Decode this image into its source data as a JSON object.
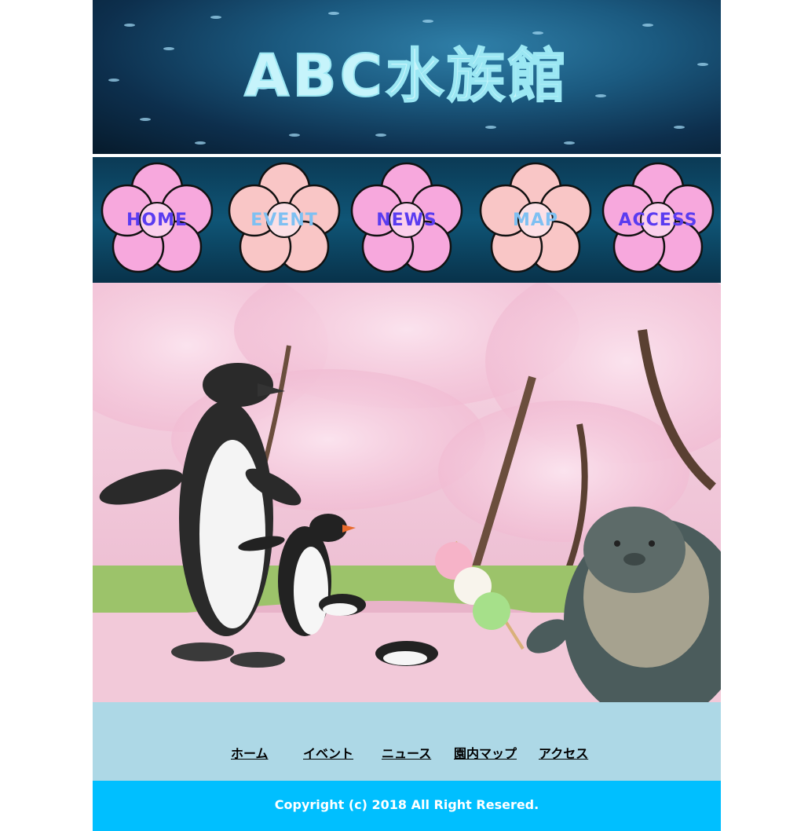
{
  "header": {
    "title": "ABC水族館"
  },
  "nav": {
    "items": [
      {
        "label": "HOME",
        "label_color": "#5a3cf0"
      },
      {
        "label": "EVENT",
        "label_color": "#7ec0f2"
      },
      {
        "label": "NEWS",
        "label_color": "#5a3cf0"
      },
      {
        "label": "MAP",
        "label_color": "#7ec0f2"
      },
      {
        "label": "ACCESS",
        "label_color": "#5a3cf0"
      }
    ],
    "flower_icon": "sakura-flower-icon"
  },
  "hero": {
    "image": "penguins-and-seal-under-cherry-blossoms"
  },
  "footer": {
    "links": [
      "ホーム",
      "イベント",
      "ニュース",
      "園内マップ",
      "アクセス"
    ],
    "copyright": "Copyright (c) 2018 All Right Resered."
  },
  "colors": {
    "footer_nav_bg": "#add8e6",
    "copyright_bg": "#00bfff",
    "header_title": "#c6f4fb",
    "flower_pink": "#f7a8dd",
    "flower_peach": "#f9c6c6"
  }
}
